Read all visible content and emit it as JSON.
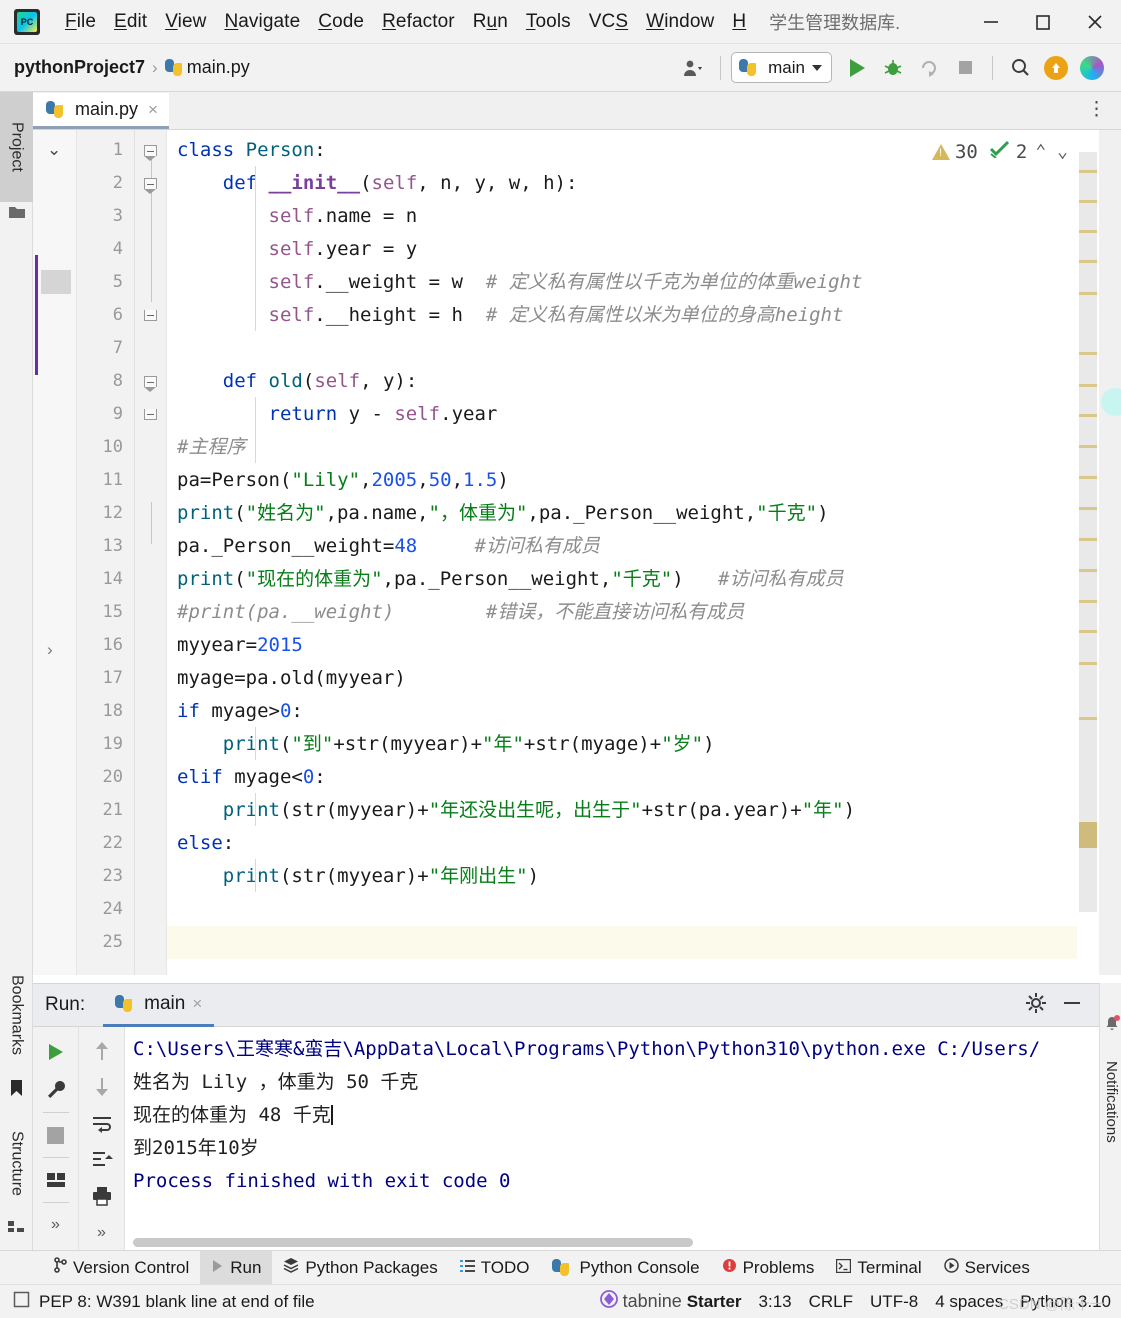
{
  "window": {
    "title": "学生管理数据库.",
    "app_icon": "pycharm-logo",
    "minimize": "minimize-icon",
    "maximize": "maximize-icon",
    "close": "close-icon"
  },
  "menubar": {
    "items": [
      {
        "label": "File",
        "mnemonic": "F"
      },
      {
        "label": "Edit",
        "mnemonic": "E"
      },
      {
        "label": "View",
        "mnemonic": "V"
      },
      {
        "label": "Navigate",
        "mnemonic": "N"
      },
      {
        "label": "Code",
        "mnemonic": "C"
      },
      {
        "label": "Refactor",
        "mnemonic": "R"
      },
      {
        "label": "Run",
        "mnemonic": "u"
      },
      {
        "label": "Tools",
        "mnemonic": "T"
      },
      {
        "label": "VCS",
        "mnemonic": "S"
      },
      {
        "label": "Window",
        "mnemonic": "W"
      },
      {
        "label": "H",
        "mnemonic": "H"
      }
    ]
  },
  "navbar": {
    "project": "pythonProject7",
    "separator": "›",
    "file": "main.py",
    "run_config": "main",
    "icons": [
      "user-avatar-icon",
      "run-icon",
      "debug-icon",
      "coverage-icon",
      "stop-icon",
      "search-icon",
      "update-project-icon",
      "ide-features-icon"
    ]
  },
  "left_tabs": [
    {
      "label": "Project",
      "active": true
    },
    {
      "label": "Bookmarks",
      "active": false
    },
    {
      "label": "Structure",
      "active": false
    }
  ],
  "editor": {
    "tab": {
      "label": "main.py",
      "close": "×"
    },
    "options_icon": "more-options-icon",
    "inspection": {
      "warnings": "30",
      "checks": "2",
      "prev": "⌃",
      "next": "⌄"
    },
    "first_line": 1,
    "total_lines": 25,
    "highlighted_line": 25,
    "lines": [
      {
        "n": 1,
        "tokens": [
          {
            "t": "class",
            "c": "kw"
          },
          {
            "t": " ",
            "c": "pln"
          },
          {
            "t": "Person",
            "c": "fn"
          },
          {
            "t": ":",
            "c": "pln"
          }
        ]
      },
      {
        "n": 2,
        "tokens": [
          {
            "t": "    ",
            "c": "pln"
          },
          {
            "t": "def",
            "c": "kw"
          },
          {
            "t": " ",
            "c": "pln"
          },
          {
            "t": "__init__",
            "c": "fnd"
          },
          {
            "t": "(",
            "c": "pln"
          },
          {
            "t": "self",
            "c": "slf"
          },
          {
            "t": ", n, y, w, h):",
            "c": "pln"
          }
        ]
      },
      {
        "n": 3,
        "tokens": [
          {
            "t": "        ",
            "c": "pln"
          },
          {
            "t": "self",
            "c": "slf"
          },
          {
            "t": ".name = n",
            "c": "pln"
          }
        ]
      },
      {
        "n": 4,
        "tokens": [
          {
            "t": "        ",
            "c": "pln"
          },
          {
            "t": "self",
            "c": "slf"
          },
          {
            "t": ".year = y",
            "c": "pln"
          }
        ]
      },
      {
        "n": 5,
        "tokens": [
          {
            "t": "        ",
            "c": "pln"
          },
          {
            "t": "self",
            "c": "slf"
          },
          {
            "t": ".__weight = w  ",
            "c": "pln"
          },
          {
            "t": "# 定义私有属性以千克为单位的体重weight",
            "c": "cmt"
          }
        ]
      },
      {
        "n": 6,
        "tokens": [
          {
            "t": "        ",
            "c": "pln"
          },
          {
            "t": "self",
            "c": "slf"
          },
          {
            "t": ".__height = h  ",
            "c": "pln"
          },
          {
            "t": "# 定义私有属性以米为单位的身高height",
            "c": "cmt"
          }
        ]
      },
      {
        "n": 7,
        "tokens": []
      },
      {
        "n": 8,
        "tokens": [
          {
            "t": "    ",
            "c": "pln"
          },
          {
            "t": "def",
            "c": "kw"
          },
          {
            "t": " ",
            "c": "pln"
          },
          {
            "t": "old",
            "c": "fn"
          },
          {
            "t": "(",
            "c": "pln"
          },
          {
            "t": "self",
            "c": "slf"
          },
          {
            "t": ", y):",
            "c": "pln"
          }
        ]
      },
      {
        "n": 9,
        "tokens": [
          {
            "t": "        ",
            "c": "pln"
          },
          {
            "t": "return",
            "c": "kw"
          },
          {
            "t": " y - ",
            "c": "pln"
          },
          {
            "t": "self",
            "c": "slf"
          },
          {
            "t": ".year",
            "c": "pln"
          }
        ]
      },
      {
        "n": 10,
        "tokens": [
          {
            "t": "#主程序",
            "c": "cmt"
          }
        ]
      },
      {
        "n": 11,
        "tokens": [
          {
            "t": "pa=Person(",
            "c": "pln"
          },
          {
            "t": "\"Lily\"",
            "c": "str"
          },
          {
            "t": ",",
            "c": "pln"
          },
          {
            "t": "2005",
            "c": "num"
          },
          {
            "t": ",",
            "c": "pln"
          },
          {
            "t": "50",
            "c": "num"
          },
          {
            "t": ",",
            "c": "pln"
          },
          {
            "t": "1.5",
            "c": "num"
          },
          {
            "t": ")",
            "c": "pln"
          }
        ]
      },
      {
        "n": 12,
        "tokens": [
          {
            "t": "print",
            "c": "fn"
          },
          {
            "t": "(",
            "c": "pln"
          },
          {
            "t": "\"姓名为\"",
            "c": "str"
          },
          {
            "t": ",pa.name,",
            "c": "pln"
          },
          {
            "t": "\"，体重为\"",
            "c": "str"
          },
          {
            "t": ",pa._Person__weight,",
            "c": "pln"
          },
          {
            "t": "\"千克\"",
            "c": "str"
          },
          {
            "t": ")",
            "c": "pln"
          }
        ]
      },
      {
        "n": 13,
        "tokens": [
          {
            "t": "pa._Person__weight=",
            "c": "pln"
          },
          {
            "t": "48",
            "c": "num"
          },
          {
            "t": "     ",
            "c": "pln"
          },
          {
            "t": "#访问私有成员",
            "c": "cmt"
          }
        ]
      },
      {
        "n": 14,
        "tokens": [
          {
            "t": "print",
            "c": "fn"
          },
          {
            "t": "(",
            "c": "pln"
          },
          {
            "t": "\"现在的体重为\"",
            "c": "str"
          },
          {
            "t": ",pa._Person__weight,",
            "c": "pln"
          },
          {
            "t": "\"千克\"",
            "c": "str"
          },
          {
            "t": ")",
            "c": "pln"
          },
          {
            "t": "   ",
            "c": "pln"
          },
          {
            "t": "#访问私有成员",
            "c": "cmt"
          }
        ]
      },
      {
        "n": 15,
        "tokens": [
          {
            "t": "#print(pa.__weight)        #错误，不能直接访问私有成员",
            "c": "cmt"
          }
        ]
      },
      {
        "n": 16,
        "tokens": [
          {
            "t": "myyear=",
            "c": "pln"
          },
          {
            "t": "2015",
            "c": "num"
          }
        ]
      },
      {
        "n": 17,
        "tokens": [
          {
            "t": "myage=pa.old(myyear)",
            "c": "pln"
          }
        ]
      },
      {
        "n": 18,
        "tokens": [
          {
            "t": "if",
            "c": "kw"
          },
          {
            "t": " myage>",
            "c": "pln"
          },
          {
            "t": "0",
            "c": "num"
          },
          {
            "t": ":",
            "c": "pln"
          }
        ]
      },
      {
        "n": 19,
        "tokens": [
          {
            "t": "    ",
            "c": "pln"
          },
          {
            "t": "print",
            "c": "fn"
          },
          {
            "t": "(",
            "c": "pln"
          },
          {
            "t": "\"到\"",
            "c": "str"
          },
          {
            "t": "+str(myyear)+",
            "c": "pln"
          },
          {
            "t": "\"年\"",
            "c": "str"
          },
          {
            "t": "+str(myage)+",
            "c": "pln"
          },
          {
            "t": "\"岁\"",
            "c": "str"
          },
          {
            "t": ")",
            "c": "pln"
          }
        ]
      },
      {
        "n": 20,
        "tokens": [
          {
            "t": "elif",
            "c": "kw"
          },
          {
            "t": " myage<",
            "c": "pln"
          },
          {
            "t": "0",
            "c": "num"
          },
          {
            "t": ":",
            "c": "pln"
          }
        ]
      },
      {
        "n": 21,
        "tokens": [
          {
            "t": "    ",
            "c": "pln"
          },
          {
            "t": "print",
            "c": "fn"
          },
          {
            "t": "(str(myyear)+",
            "c": "pln"
          },
          {
            "t": "\"年还没出生呢，出生于\"",
            "c": "str"
          },
          {
            "t": "+str(pa.year)+",
            "c": "pln"
          },
          {
            "t": "\"年\"",
            "c": "str"
          },
          {
            "t": ")",
            "c": "pln"
          }
        ]
      },
      {
        "n": 22,
        "tokens": [
          {
            "t": "else",
            "c": "kw"
          },
          {
            "t": ":",
            "c": "pln"
          }
        ]
      },
      {
        "n": 23,
        "tokens": [
          {
            "t": "    ",
            "c": "pln"
          },
          {
            "t": "print",
            "c": "fn"
          },
          {
            "t": "(str(myyear)+",
            "c": "pln"
          },
          {
            "t": "\"年刚出生\"",
            "c": "str"
          },
          {
            "t": ")",
            "c": "pln"
          }
        ]
      },
      {
        "n": 24,
        "tokens": []
      },
      {
        "n": 25,
        "tokens": []
      }
    ]
  },
  "run_panel": {
    "label": "Run:",
    "tab": "main",
    "tab_close": "×",
    "settings_icon": "gear-icon",
    "hide_icon": "minimize-icon",
    "tool_icons": [
      "rerun-icon",
      "wrench-icon",
      "stop-icon",
      "layout-icon",
      "expand-icon",
      "up-icon",
      "down-icon",
      "soft-wrap-icon",
      "scroll-end-icon",
      "print-icon",
      "expand-icon"
    ],
    "output": [
      "C:\\Users\\王寒寒&蛮吉\\AppData\\Local\\Programs\\Python\\Python310\\python.exe C:/Users/",
      "姓名为 Lily ，体重为 50 千克",
      "现在的体重为 48 千克",
      "到2015年10岁",
      "",
      "Process finished with exit code 0"
    ]
  },
  "notifications": {
    "label": "Notifications",
    "icon": "bell-icon"
  },
  "tool_window_bar": {
    "items": [
      {
        "label": "Version Control",
        "icon": "branch-icon",
        "active": false
      },
      {
        "label": "Run",
        "icon": "run-icon",
        "active": true
      },
      {
        "label": "Python Packages",
        "icon": "packages-icon",
        "active": false
      },
      {
        "label": "TODO",
        "icon": "todo-icon",
        "active": false
      },
      {
        "label": "Python Console",
        "icon": "python-icon",
        "active": false
      },
      {
        "label": "Problems",
        "icon": "problems-icon",
        "active": false
      },
      {
        "label": "Terminal",
        "icon": "terminal-icon",
        "active": false
      },
      {
        "label": "Services",
        "icon": "services-icon",
        "active": false
      }
    ]
  },
  "statusbar": {
    "message_icon": "info-icon",
    "message": "PEP 8: W391 blank line at end of file",
    "tabnine": {
      "name": "tabnine",
      "plan": "Starter",
      "icon": "tabnine-icon"
    },
    "caret_position": "3:13",
    "line_separator": "CRLF",
    "encoding": "UTF-8",
    "indent": "4 spaces",
    "interpreter": "Python 3.10",
    "watermark": "CSDN @陈十一"
  }
}
